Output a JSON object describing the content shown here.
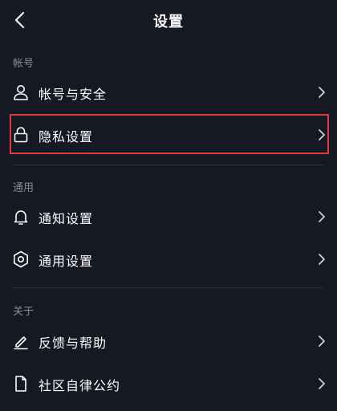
{
  "header": {
    "title": "设置"
  },
  "sections": [
    {
      "label": "帐号",
      "items": [
        {
          "label": "帐号与安全",
          "icon": "user-icon"
        },
        {
          "label": "隐私设置",
          "icon": "lock-icon"
        }
      ]
    },
    {
      "label": "通用",
      "items": [
        {
          "label": "通知设置",
          "icon": "bell-icon"
        },
        {
          "label": "通用设置",
          "icon": "gear-icon"
        }
      ]
    },
    {
      "label": "关于",
      "items": [
        {
          "label": "反馈与帮助",
          "icon": "edit-icon"
        },
        {
          "label": "社区自律公约",
          "icon": "document-icon"
        }
      ]
    }
  ],
  "colors": {
    "background": "#161823",
    "highlight": "#e0393e",
    "muted": "#8a8b91"
  }
}
